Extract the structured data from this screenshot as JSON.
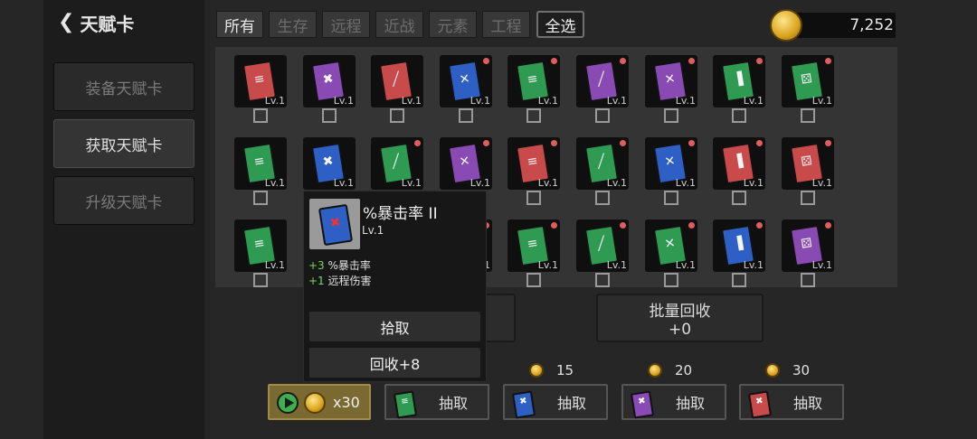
{
  "header": {
    "back_icon": "chevron-left-icon",
    "title": "天赋卡"
  },
  "sidebar": {
    "items": [
      {
        "label": "装备天赋卡",
        "active": false
      },
      {
        "label": "获取天赋卡",
        "active": true
      },
      {
        "label": "升级天赋卡",
        "active": false
      }
    ]
  },
  "filters": {
    "tabs": [
      "所有",
      "生存",
      "远程",
      "近战",
      "元素",
      "工程"
    ],
    "select_all": "全选"
  },
  "currency": {
    "icon": "gold-coin-icon",
    "value": "7,252"
  },
  "colors": {
    "red": "#c84a4a",
    "purple": "#8a4ab4",
    "blue": "#2e5fc4",
    "green": "#2e9a52",
    "new_dot": "#e05d5d",
    "stat_plus": "#7cd56a"
  },
  "cards": {
    "level_label": "Lv.1",
    "rows": [
      [
        {
          "color": "red",
          "icon": "wind-icon",
          "dot": false
        },
        {
          "color": "purple",
          "icon": "crit-icon",
          "dot": false
        },
        {
          "color": "red",
          "icon": "sword-icon",
          "dot": false
        },
        {
          "color": "blue",
          "icon": "crossed-swords-icon",
          "dot": true
        },
        {
          "color": "green",
          "icon": "wind-icon",
          "dot": true
        },
        {
          "color": "purple",
          "icon": "sword-icon",
          "dot": true
        },
        {
          "color": "purple",
          "icon": "crossed-swords-icon",
          "dot": true
        },
        {
          "color": "green",
          "icon": "boot-icon",
          "dot": true
        },
        {
          "color": "green",
          "icon": "dice-icon",
          "dot": true
        }
      ],
      [
        {
          "color": "green",
          "icon": "wind-icon",
          "dot": false
        },
        {
          "color": "blue",
          "icon": "crit-icon",
          "dot": false
        },
        {
          "color": "green",
          "icon": "sword-icon",
          "dot": true
        },
        {
          "color": "purple",
          "icon": "crossed-swords-icon",
          "dot": true
        },
        {
          "color": "red",
          "icon": "wind-icon",
          "dot": true
        },
        {
          "color": "green",
          "icon": "sword-icon",
          "dot": true
        },
        {
          "color": "blue",
          "icon": "crossed-swords-icon",
          "dot": true
        },
        {
          "color": "red",
          "icon": "boot-icon",
          "dot": true
        },
        {
          "color": "red",
          "icon": "dice-icon",
          "dot": true
        }
      ],
      [
        {
          "color": "green",
          "icon": "wind-icon",
          "dot": false
        },
        {
          "color": "blue",
          "icon": "crit-icon",
          "dot": false
        },
        {
          "color": "green",
          "icon": "sword-icon",
          "dot": true
        },
        {
          "color": "purple",
          "icon": "crossed-swords-icon",
          "dot": true
        },
        {
          "color": "green",
          "icon": "wind-icon",
          "dot": true
        },
        {
          "color": "green",
          "icon": "sword-icon",
          "dot": true
        },
        {
          "color": "green",
          "icon": "crossed-swords-icon",
          "dot": true
        },
        {
          "color": "blue",
          "icon": "boot-icon",
          "dot": true
        },
        {
          "color": "purple",
          "icon": "dice-icon",
          "dot": true
        }
      ]
    ]
  },
  "popup": {
    "card_color": "blue",
    "card_icon": "crit-icon",
    "name": "%暴击率 II",
    "level": "Lv.1",
    "stats": [
      {
        "plus": "+3",
        "text": " %暴击率"
      },
      {
        "plus": "+1",
        "text": " 远程伤害"
      }
    ],
    "pickup": "拾取",
    "recycle": "回收+8"
  },
  "actions": {
    "batch_recycle_line1": "批量回收",
    "batch_recycle_line2": "+0"
  },
  "draw": {
    "ad_label": "x30",
    "ad_icons": [
      "play-icon",
      "gold-coin-icon"
    ],
    "buttons": [
      {
        "color": "green",
        "icon": "wind-icon",
        "label": "抽取",
        "price": ""
      },
      {
        "color": "blue",
        "icon": "crit-icon",
        "label": "抽取",
        "price": "15"
      },
      {
        "color": "purple",
        "icon": "crit-icon",
        "label": "抽取",
        "price": "20"
      },
      {
        "color": "red",
        "icon": "crit-icon",
        "label": "抽取",
        "price": "30"
      }
    ]
  }
}
